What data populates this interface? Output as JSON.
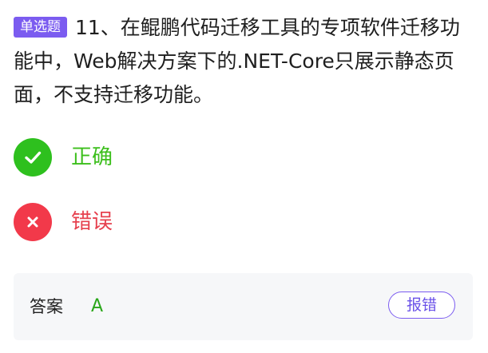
{
  "question": {
    "type_badge": "单选题",
    "text": "11、在鲲鹏代码迁移工具的专项软件迁移功能中，Web解决方案下的.NET-Core只展示静态页面，不支持迁移功能。"
  },
  "options": [
    {
      "icon": "check-icon",
      "label": "正确",
      "color": "#3cbf1c"
    },
    {
      "icon": "close-icon",
      "label": "错误",
      "color": "#e6404e"
    }
  ],
  "answer": {
    "label": "答案",
    "value": "A",
    "report_label": "报错"
  },
  "colors": {
    "badge": "#7b5cf0",
    "correct": "#2ec01e",
    "wrong": "#f2394a",
    "panel": "#f6f7f9"
  }
}
